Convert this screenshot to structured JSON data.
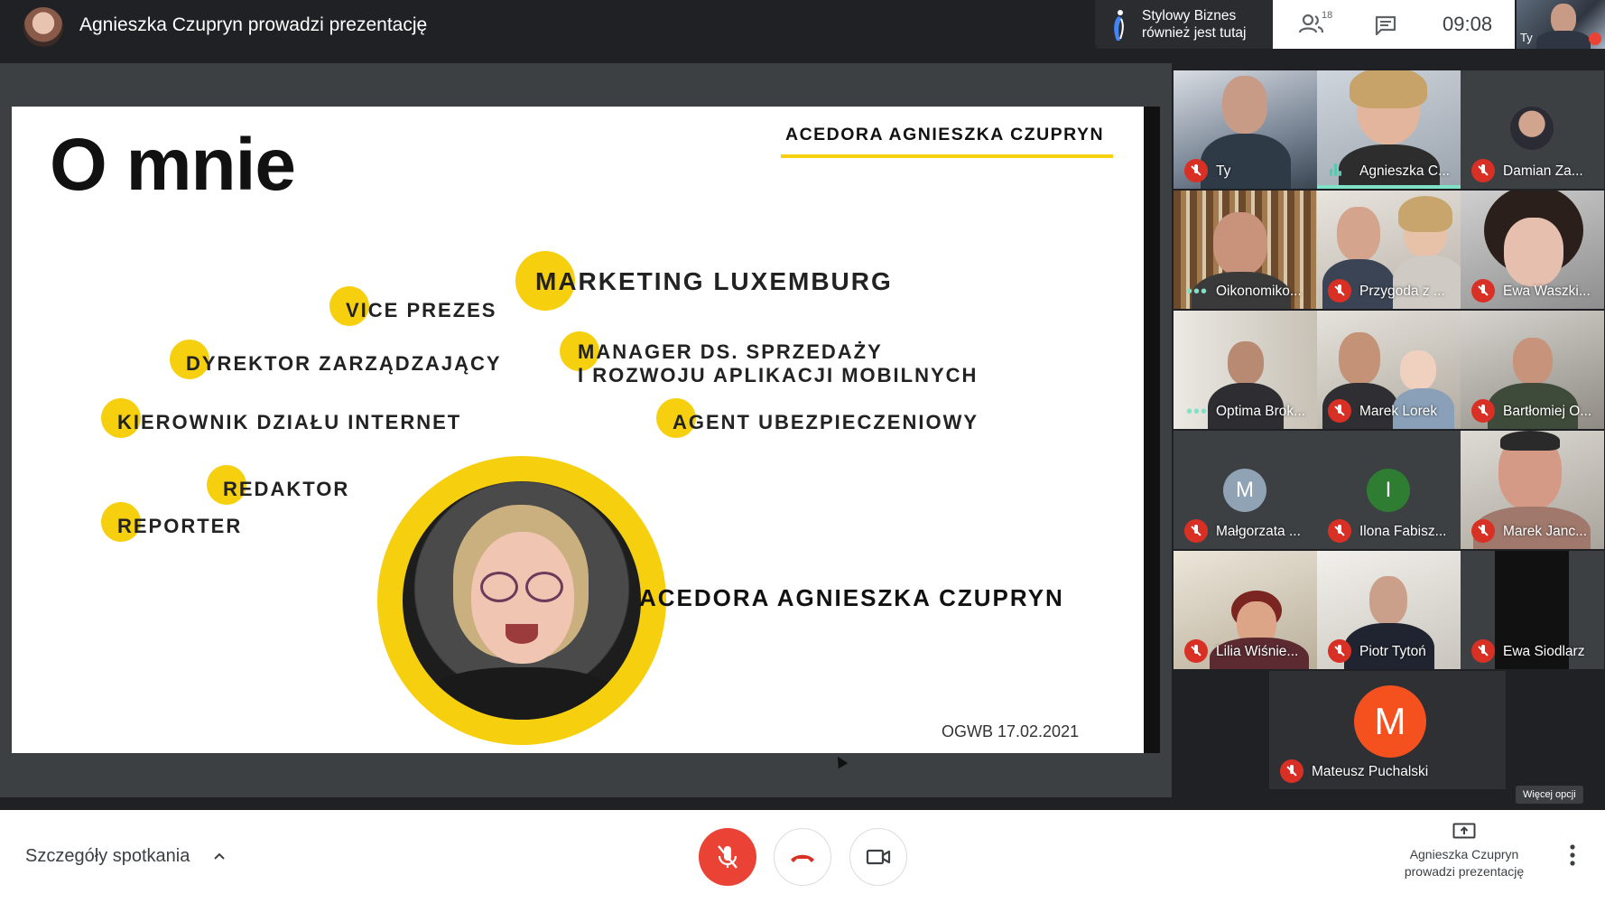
{
  "topbar": {
    "presenter_title": "Agnieszka Czupryn prowadzi prezentację",
    "company_line1": "Stylowy Biznes",
    "company_line2": "również jest tutaj",
    "people_count": "18",
    "time": "09:08",
    "self_label": "Ty"
  },
  "slide": {
    "title": "O mnie",
    "header": "ACEDORA AGNIESZKA CZUPRYN",
    "roles": [
      "MARKETING LUXEMBURG",
      "VICE PREZES",
      "DYREKTOR ZARZĄDZAJĄCY",
      "MANAGER DS. SPRZEDAŻY",
      "I ROZWOJU APLIKACJI MOBILNYCH",
      "KIEROWNIK DZIAŁU INTERNET",
      "AGENT UBEZPIECZENIOWY",
      "REDAKTOR",
      "REPORTER"
    ],
    "name": "ACEDORA AGNIESZKA CZUPRYN",
    "date": "OGWB 17.02.2021"
  },
  "participants": [
    {
      "name": "Ty",
      "state": "muted"
    },
    {
      "name": "Agnieszka C...",
      "state": "speaking"
    },
    {
      "name": "Damian Za...",
      "state": "muted"
    },
    {
      "name": "Oikonomiko...",
      "state": "dots"
    },
    {
      "name": "Przygoda z ...",
      "state": "muted"
    },
    {
      "name": "Ewa Waszki...",
      "state": "muted"
    },
    {
      "name": "Optima Brok...",
      "state": "dots"
    },
    {
      "name": "Marek Lorek",
      "state": "muted"
    },
    {
      "name": "Bartłomiej O...",
      "state": "muted"
    },
    {
      "name": "Małgorzata ...",
      "state": "muted",
      "avatar_letter": "M",
      "avatar_color": "#8fa3b5"
    },
    {
      "name": "Ilona Fabisz...",
      "state": "muted",
      "avatar_letter": "I",
      "avatar_color": "#2e7d32"
    },
    {
      "name": "Marek Janc...",
      "state": "muted"
    },
    {
      "name": "Lilia Wiśnie...",
      "state": "muted"
    },
    {
      "name": "Piotr Tytoń",
      "state": "muted"
    },
    {
      "name": "Ewa Siodlarz",
      "state": "muted"
    },
    {
      "name": "Mateusz Puchalski",
      "state": "muted",
      "avatar_letter": "M",
      "avatar_color": "#f4511e"
    }
  ],
  "more_options": "Więcej opcji",
  "bottombar": {
    "details": "Szczegóły spotkania",
    "present_line1": "Agnieszka Czupryn",
    "present_line2": "prowadzi prezentację"
  },
  "colors": {
    "accent_yellow": "#f6cf0f",
    "mic_red": "#ea4335",
    "speaking_teal": "#7ee2c6"
  }
}
